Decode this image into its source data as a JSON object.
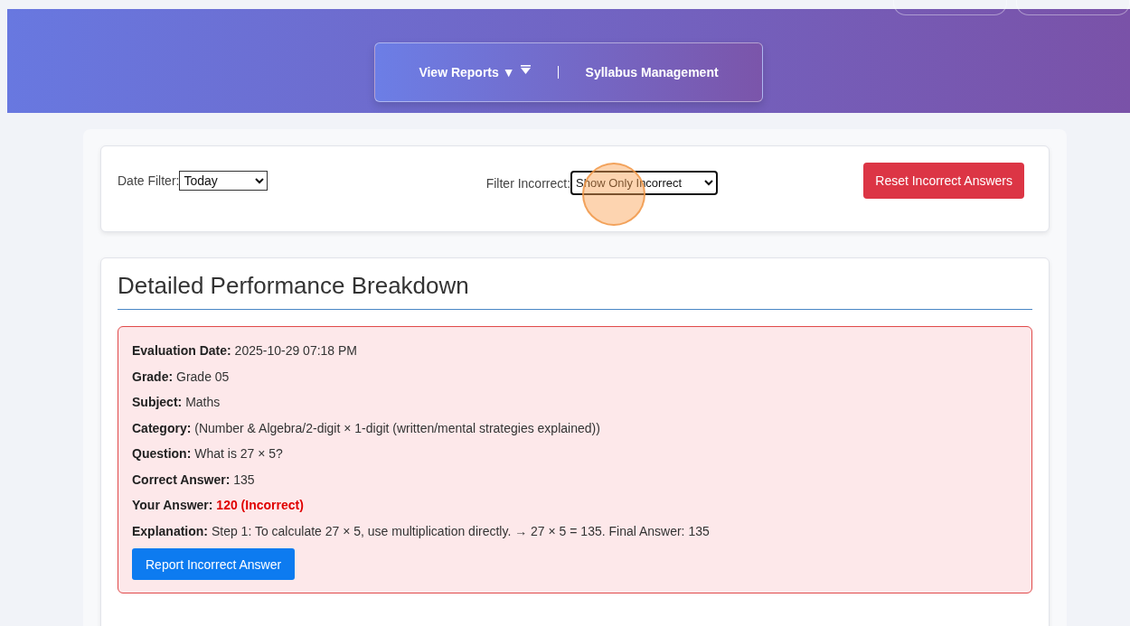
{
  "nav": {
    "items": [
      {
        "label": "View Reports ▼",
        "kind": "dropdown"
      },
      {
        "label": "Syllabus Management",
        "kind": "link"
      }
    ]
  },
  "filters": {
    "date": {
      "label": "Date Filter:",
      "value": "Today"
    },
    "incorrect": {
      "label": "Filter Incorrect:",
      "value": "Show Only Incorrect"
    },
    "reset_button": "Reset Incorrect Answers"
  },
  "breakdown": {
    "title": "Detailed Performance Breakdown",
    "fields": [
      {
        "label": "Evaluation Date:",
        "value": "2025-10-29 07:18 PM",
        "kind": "plain"
      },
      {
        "label": "Grade:",
        "value": "Grade 05",
        "kind": "plain"
      },
      {
        "label": "Subject:",
        "value": "Maths",
        "kind": "plain"
      },
      {
        "label": "Category:",
        "value": "(Number & Algebra/2-digit × 1-digit (written/mental strategies explained))",
        "kind": "plain"
      },
      {
        "label": "Question:",
        "value": "What is 27 × 5?",
        "kind": "plain"
      },
      {
        "label": "Correct Answer:",
        "value": "135",
        "kind": "plain"
      },
      {
        "label": "Your Answer:",
        "value": "120 (Incorrect)",
        "kind": "wrong"
      },
      {
        "label": "Explanation:",
        "value": "Step 1: To calculate 27 × 5, use multiplication directly. → 27 × 5 = 135. Final Answer: 135",
        "kind": "plain"
      }
    ],
    "report_button": "Report Incorrect Answer"
  }
}
